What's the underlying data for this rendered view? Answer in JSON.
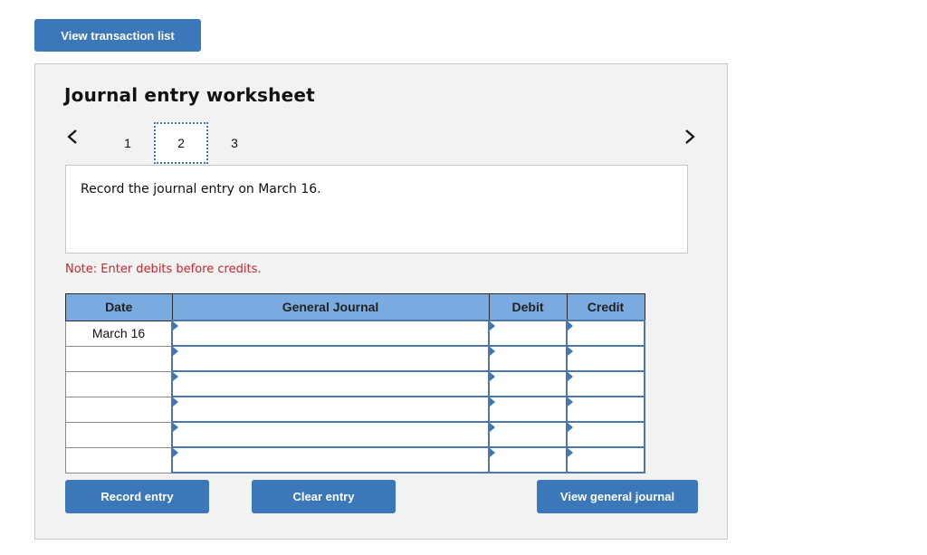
{
  "top_button": {
    "label": "View transaction list"
  },
  "worksheet": {
    "title": "Journal entry worksheet",
    "pager": {
      "prev_icon": "chevron-left-icon",
      "next_icon": "chevron-right-icon",
      "pages": [
        "1",
        "2",
        "3"
      ],
      "active_page": "2"
    },
    "instruction": "Record the journal entry on March 16.",
    "note": "Note: Enter debits before credits.",
    "table": {
      "headers": {
        "date": "Date",
        "general_journal": "General Journal",
        "debit": "Debit",
        "credit": "Credit"
      },
      "rows": [
        {
          "date": "March 16",
          "account": "",
          "debit": "",
          "credit": ""
        },
        {
          "date": "",
          "account": "",
          "debit": "",
          "credit": ""
        },
        {
          "date": "",
          "account": "",
          "debit": "",
          "credit": ""
        },
        {
          "date": "",
          "account": "",
          "debit": "",
          "credit": ""
        },
        {
          "date": "",
          "account": "",
          "debit": "",
          "credit": ""
        },
        {
          "date": "",
          "account": "",
          "debit": "",
          "credit": ""
        }
      ]
    },
    "buttons": {
      "record": "Record entry",
      "clear": "Clear entry",
      "view_general_journal": "View general journal"
    }
  },
  "colors": {
    "button_blue": "#3c78b9",
    "header_blue": "#7aabe0",
    "note_red": "#c0272d",
    "panel_bg": "#f2f2f2"
  }
}
